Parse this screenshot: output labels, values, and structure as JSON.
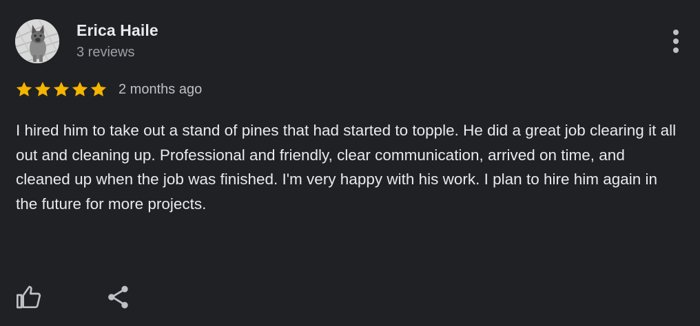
{
  "reviewer": {
    "name": "Erica Haile",
    "review_count": "3 reviews",
    "avatar_icon": "dog-photo-avatar"
  },
  "rating": {
    "stars": 5,
    "max_stars": 5,
    "star_color": "#f4b400",
    "date": "2 months ago"
  },
  "review": {
    "text": "I hired him to take out a stand of pines that had started to topple. He did a great job clearing it all out and cleaning up. Professional and friendly, clear communication, arrived on time, and cleaned up when the job was finished. I'm very happy with his work. I plan to hire him again in the future for more projects."
  },
  "actions": {
    "more_icon": "more-vert-icon",
    "like_icon": "thumb-up-icon",
    "share_icon": "share-icon"
  },
  "colors": {
    "background": "#202124",
    "primary_text": "#e8eaed",
    "secondary_text": "#9aa0a6",
    "icon": "#bdc1c6"
  }
}
